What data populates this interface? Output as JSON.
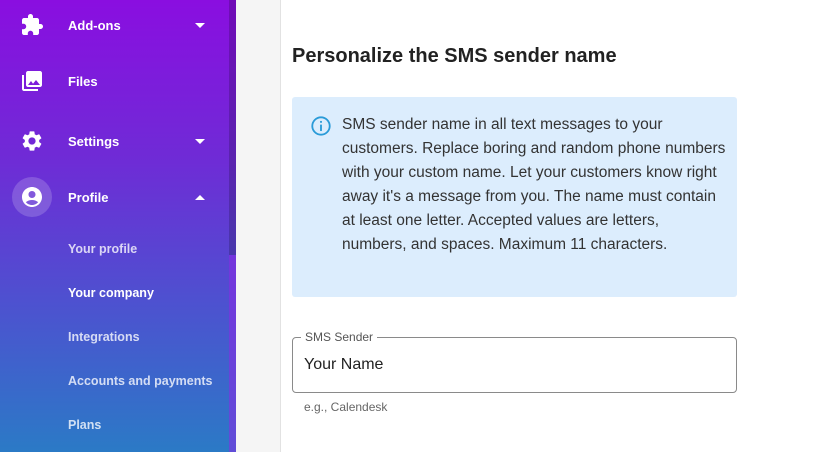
{
  "sidebar": {
    "items": [
      {
        "label": "Add-ons",
        "icon": "puzzle-icon"
      },
      {
        "label": "Files",
        "icon": "images-icon"
      },
      {
        "label": "Settings",
        "icon": "gear-icon"
      },
      {
        "label": "Profile",
        "icon": "account-circle-icon"
      }
    ],
    "profile_subitems": [
      {
        "label": "Your profile"
      },
      {
        "label": "Your company"
      },
      {
        "label": "Integrations"
      },
      {
        "label": "Accounts and payments"
      },
      {
        "label": "Plans"
      }
    ]
  },
  "main": {
    "title": "Personalize the SMS sender name",
    "info_text": "SMS sender name in all text messages to your customers. Replace boring and random phone numbers with your custom name. Let your customers know right away it's a message from you. The name must contain at least one letter. Accepted values are letters, numbers, and spaces. Maximum 11 characters.",
    "field": {
      "label": "SMS Sender",
      "value": "Your Name",
      "hint": "e.g., Calendesk"
    }
  },
  "colors": {
    "sidebar_top": "#8a0ee0",
    "sidebar_bottom": "#2b7ac6",
    "info_bg": "#dcedfd",
    "info_icon": "#2a9bd8"
  }
}
